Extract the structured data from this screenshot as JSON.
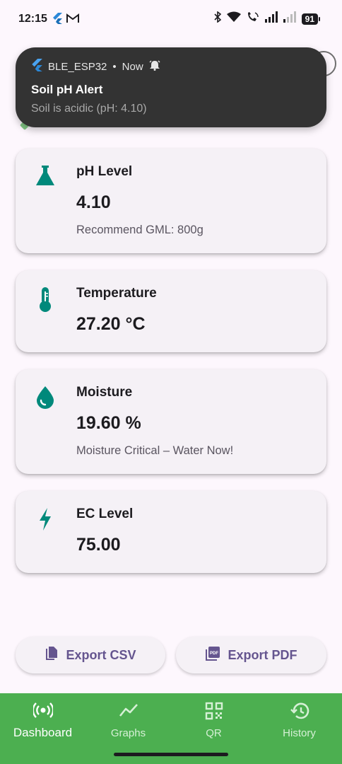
{
  "status_bar": {
    "time": "12:15",
    "battery": "91",
    "left_icons": [
      "flutter-icon",
      "gmail-icon"
    ],
    "right_icons": [
      "bluetooth-icon",
      "wifi-icon",
      "wifi-calling-icon",
      "signal-icon",
      "signal-2-icon"
    ]
  },
  "notification": {
    "app_name": "BLE_ESP32",
    "separator": "•",
    "time": "Now",
    "title": "Soil pH Alert",
    "body": "Soil is acidic (pH: 4.10)"
  },
  "cards": [
    {
      "label": "pH Level",
      "value": "4.10",
      "note": "Recommend GML: 800g",
      "icon": "flask-icon"
    },
    {
      "label": "Temperature",
      "value": "27.20 °C",
      "icon": "thermometer-icon"
    },
    {
      "label": "Moisture",
      "value": "19.60 %",
      "note": "Moisture Critical – Water Now!",
      "icon": "water-drop-icon"
    },
    {
      "label": "EC Level",
      "value": "75.00",
      "icon": "bolt-icon"
    }
  ],
  "actions": {
    "export_csv": "Export CSV",
    "export_pdf": "Export PDF"
  },
  "nav": {
    "items": [
      {
        "label": "Dashboard",
        "icon": "sensors-icon",
        "active": true
      },
      {
        "label": "Graphs",
        "icon": "line-chart-icon",
        "active": false
      },
      {
        "label": "QR",
        "icon": "qr-code-icon",
        "active": false
      },
      {
        "label": "History",
        "icon": "history-icon",
        "active": false
      }
    ]
  },
  "colors": {
    "accent_teal": "#00897b",
    "nav_green": "#4caf50",
    "button_text": "#65558f",
    "notification_bg": "#333333"
  }
}
